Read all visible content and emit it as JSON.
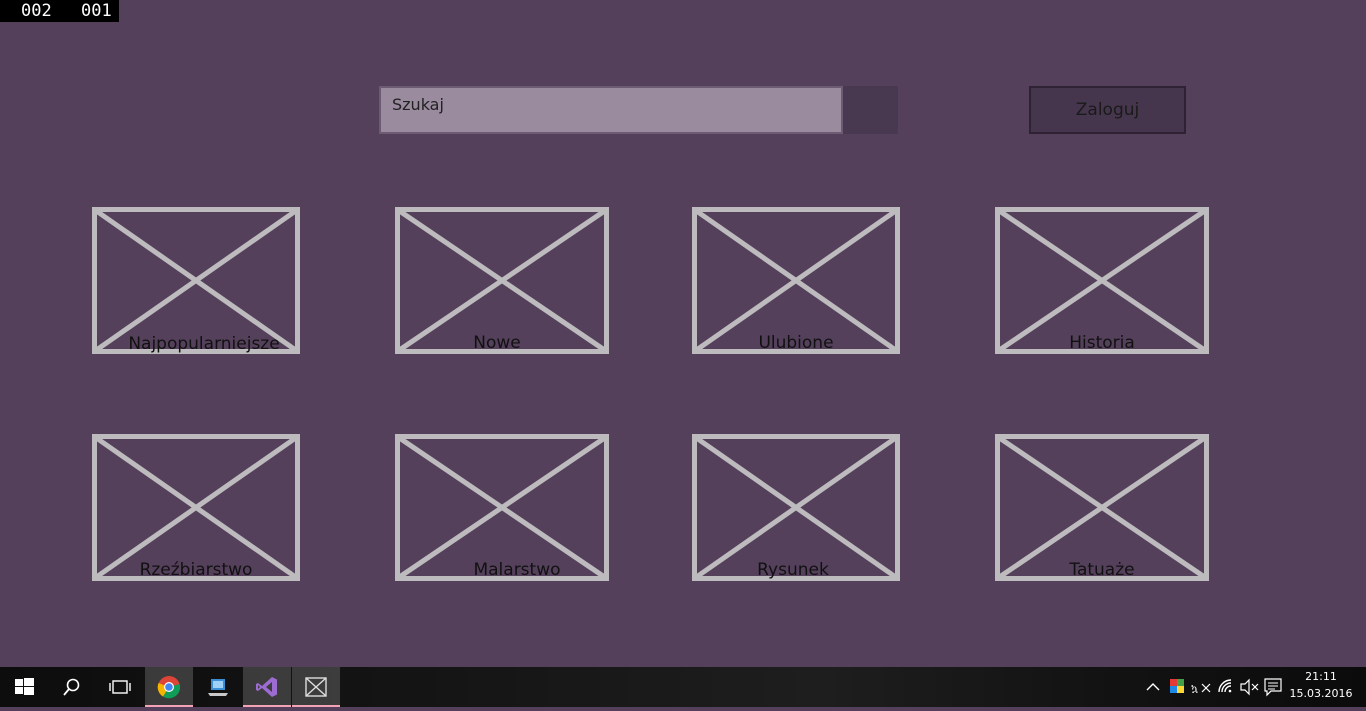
{
  "overlay": {
    "counter_a": "002",
    "counter_b": "001"
  },
  "header": {
    "search_placeholder": "Szukaj",
    "login_label": "Zaloguj"
  },
  "tiles": [
    {
      "label": "Najpopularniejsze",
      "icon": "image-placeholder-icon"
    },
    {
      "label": "Nowe",
      "icon": "image-placeholder-icon"
    },
    {
      "label": "Ulubione",
      "icon": "image-placeholder-icon"
    },
    {
      "label": "Historia",
      "icon": "image-placeholder-icon"
    },
    {
      "label": "Rzeźbiarstwo",
      "icon": "image-placeholder-icon"
    },
    {
      "label": "Malarstwo",
      "icon": "image-placeholder-icon"
    },
    {
      "label": "Rysunek",
      "icon": "image-placeholder-icon"
    },
    {
      "label": "Tatuaże",
      "icon": "image-placeholder-icon"
    }
  ],
  "taskbar": {
    "apps": [
      {
        "icon": "windows-start-icon"
      },
      {
        "icon": "search-icon"
      },
      {
        "icon": "task-view-icon"
      },
      {
        "icon": "chrome-icon"
      },
      {
        "icon": "computer-icon"
      },
      {
        "icon": "visual-studio-icon"
      },
      {
        "icon": "app-placeholder-icon"
      }
    ],
    "tray_icons": [
      "chevron-up-icon",
      "color-app-icon",
      "input-icon",
      "wifi-icon",
      "volume-muted-icon",
      "notifications-icon"
    ],
    "time": "21:11",
    "date": "15.03.2016"
  },
  "colors": {
    "background": "#54405b",
    "tile_stroke": "#bdbbbd",
    "search_bg": "#9a8b9f",
    "taskbar_accent": "#f3a3b5"
  }
}
